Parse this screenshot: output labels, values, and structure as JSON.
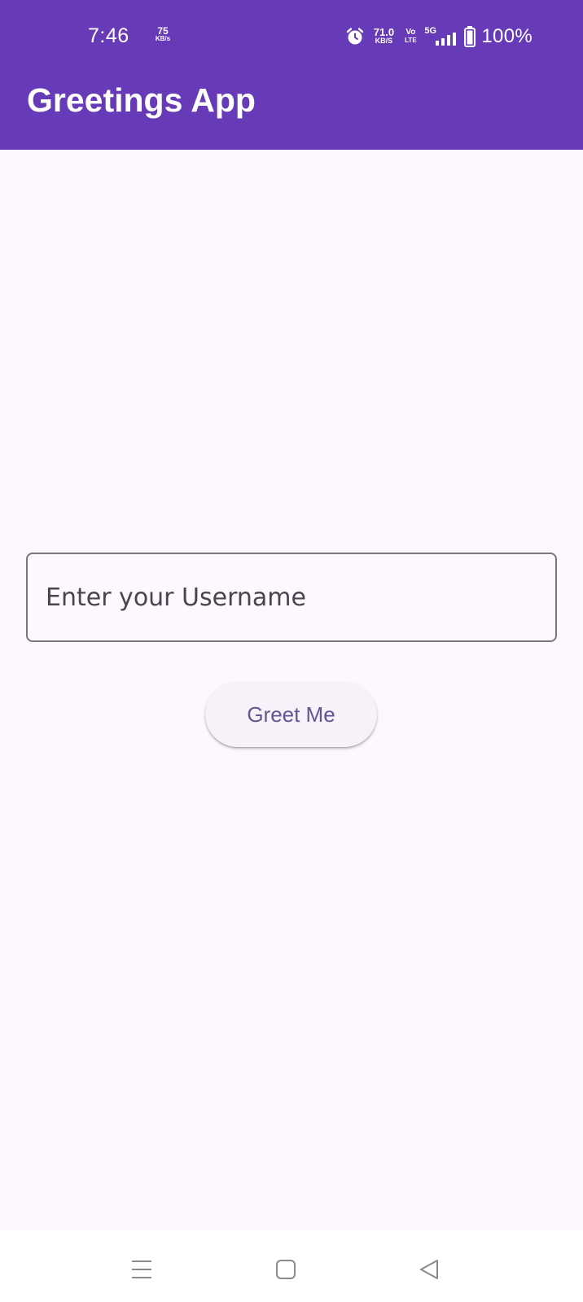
{
  "status_bar": {
    "time": "7:46",
    "data_speed_left": {
      "value": "75",
      "unit": "KB/s"
    },
    "net_speed": {
      "value": "71.0",
      "unit": "KB/S"
    },
    "volte": {
      "top": "Vo",
      "bottom": "LTE"
    },
    "network_type": "5G",
    "battery_text": "100%"
  },
  "app_bar": {
    "title": "Greetings App"
  },
  "form": {
    "username_placeholder": "Enter your Username",
    "username_value": "",
    "greet_button_label": "Greet Me"
  },
  "nav_bar": {
    "icons": [
      "menu-icon",
      "home-icon",
      "back-icon"
    ]
  },
  "colors": {
    "primary": "#673ab7",
    "background": "#fdf7fe",
    "button_text": "#65558f",
    "button_bg": "#f7f1f9",
    "outline": "#79747e"
  }
}
